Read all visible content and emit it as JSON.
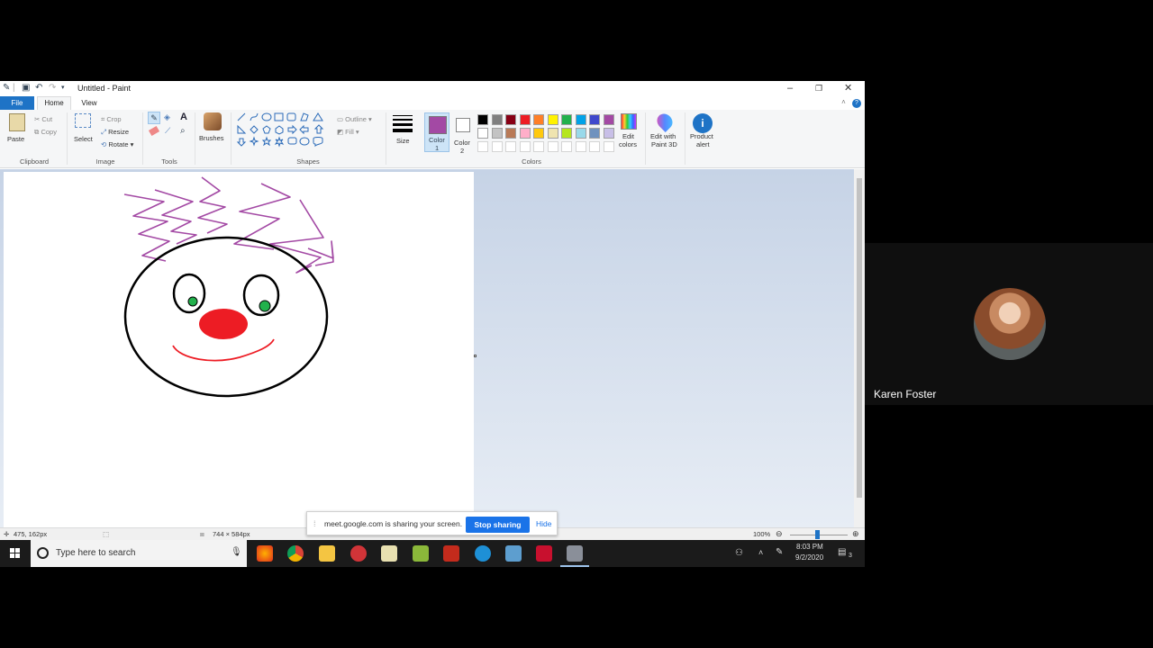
{
  "window": {
    "title": "Untitled - Paint"
  },
  "tabs": {
    "file": "File",
    "home": "Home",
    "view": "View"
  },
  "ribbon": {
    "clipboard": {
      "paste": "Paste",
      "cut": "Cut",
      "copy": "Copy",
      "label": "Clipboard"
    },
    "image": {
      "select": "Select",
      "crop": "Crop",
      "resize": "Resize",
      "rotate": "Rotate",
      "label": "Image"
    },
    "tools": {
      "label": "Tools"
    },
    "brushes": {
      "label": "Brushes"
    },
    "shapes": {
      "outline": "Outline",
      "fill": "Fill",
      "label": "Shapes"
    },
    "size": {
      "label": "Size"
    },
    "colors": {
      "color1_line1": "Color",
      "color1_line2": "1",
      "color2_line1": "Color",
      "color2_line2": "2",
      "edit_line1": "Edit",
      "edit_line2": "colors",
      "paint3d_line1": "Edit with",
      "paint3d_line2": "Paint 3D",
      "alert_line1": "Product",
      "alert_line2": "alert",
      "label": "Colors",
      "active_color1": "#a349a4",
      "palette_row1": [
        "#000000",
        "#7f7f7f",
        "#880015",
        "#ed1c24",
        "#ff7f27",
        "#fff200",
        "#22b14c",
        "#00a2e8",
        "#3f48cc",
        "#a349a4"
      ],
      "palette_row2": [
        "#ffffff",
        "#c3c3c3",
        "#b97a57",
        "#ffaec9",
        "#ffc90e",
        "#efe4b0",
        "#b5e61d",
        "#99d9ea",
        "#7092be",
        "#c8bfe7"
      ]
    }
  },
  "status": {
    "cursor_pos": "475, 162px",
    "canvas_size": "744 × 584px",
    "zoom": "100%"
  },
  "share": {
    "message": "meet.google.com is sharing your screen.",
    "stop": "Stop sharing",
    "hide": "Hide"
  },
  "taskbar": {
    "search_placeholder": "Type here to search",
    "time": "8:03 PM",
    "date": "9/2/2020",
    "notifications": "3"
  },
  "video": {
    "participant_name": "Karen Foster"
  }
}
